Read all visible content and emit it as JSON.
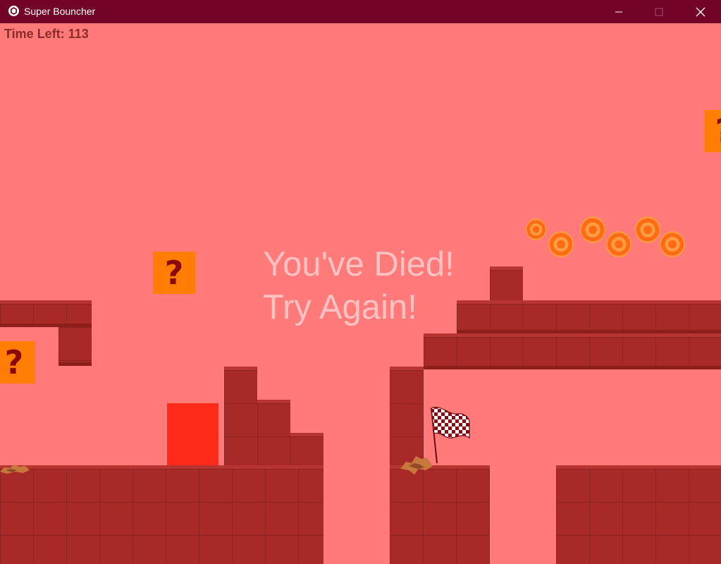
{
  "window": {
    "title": "Super Bouncher",
    "app_icon": "unity-icon",
    "controls": [
      "minimize-icon",
      "maximize-icon",
      "close-icon"
    ]
  },
  "hud": {
    "time_left": "Time Left: 113"
  },
  "message": {
    "line1": "You've Died!",
    "line2": "Try Again!"
  },
  "question_block_symbol": "?",
  "colors": {
    "titlebar": "#720427",
    "background": "#ff7a78",
    "brick": "#a82a28",
    "question_block": "#ff7d05",
    "player": "#ff2a1a",
    "message_text": "#ffc2c2",
    "hud_text": "#8c2a2a"
  }
}
